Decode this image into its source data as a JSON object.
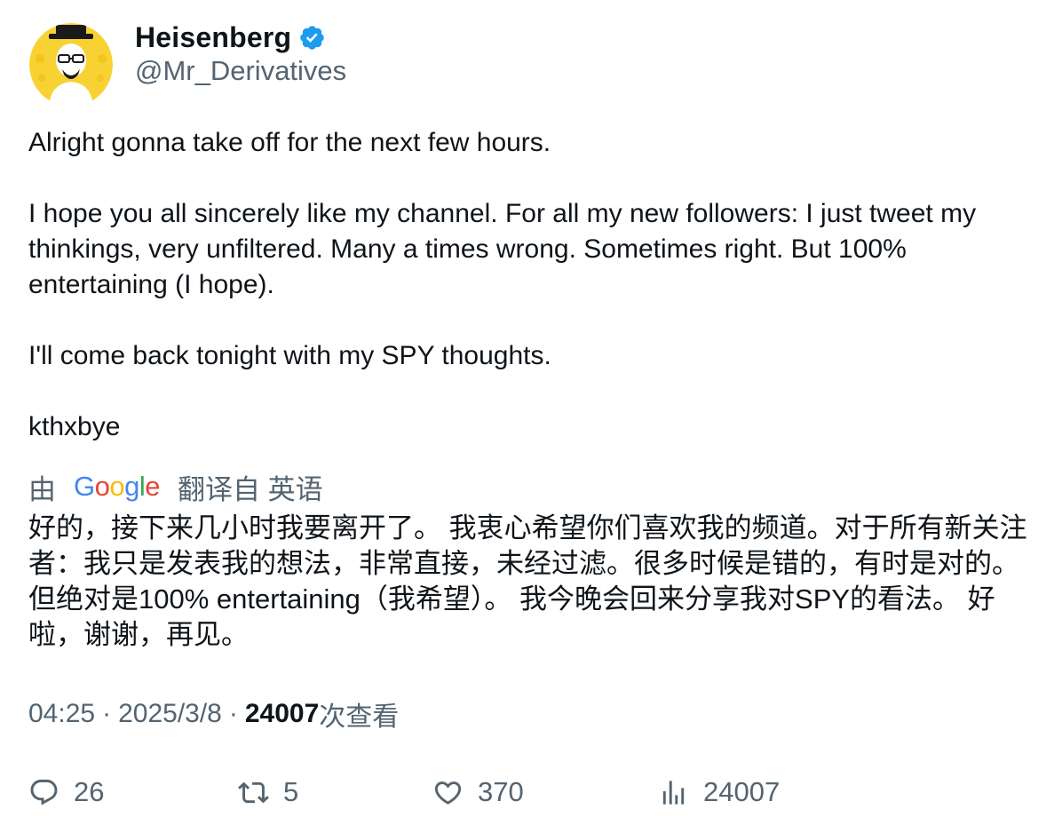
{
  "author": {
    "display_name": "Heisenberg",
    "handle": "@Mr_Derivatives",
    "avatar_icon": "heisenberg-avatar",
    "verified_icon": "verified-badge-icon",
    "verified_color": "#1d9bf0"
  },
  "tweet": {
    "paragraphs": [
      "Alright gonna take off for the next few hours.",
      "I hope you all sincerely like my channel. For all my new followers: I just tweet my thinkings, very unfiltered. Many a times wrong. Sometimes right. But 100% entertaining (I hope).",
      "I'll come back tonight with my SPY thoughts.",
      "kthxbye"
    ]
  },
  "translation": {
    "prefix": "由",
    "provider": "Google",
    "suffix": "翻译自 英语",
    "text": "好的，接下来几小时我要离开了。 我衷心希望你们喜欢我的频道。对于所有新关注者：我只是发表我的想法，非常直接，未经过滤。很多时候是错的，有时是对的。但绝对是100% entertaining（我希望）。 我今晚会回来分享我对SPY的看法。 好啦，谢谢，再见。"
  },
  "meta": {
    "time": "04:25",
    "separator": "·",
    "date": "2025/3/8",
    "views_count": "24007",
    "views_label": "次查看"
  },
  "actions": {
    "replies": "26",
    "reposts": "5",
    "likes": "370",
    "views": "24007",
    "icons": [
      "reply-icon",
      "repost-icon",
      "like-icon",
      "views-icon"
    ]
  },
  "colors": {
    "text_primary": "#0f1419",
    "text_secondary": "#536471",
    "verified": "#1d9bf0",
    "avatar_bg": "#f7d232"
  }
}
